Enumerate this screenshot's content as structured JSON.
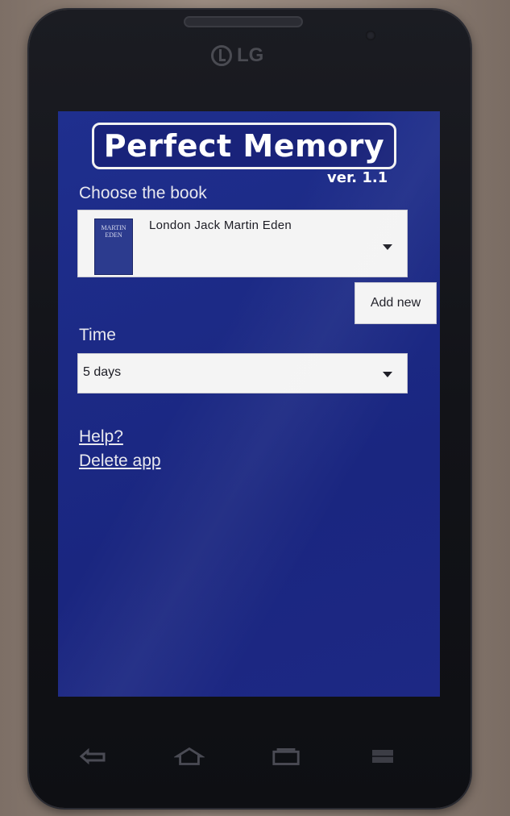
{
  "device": {
    "brand": "LG"
  },
  "app": {
    "title": "Perfect Memory",
    "version": "ver. 1.1"
  },
  "book_section": {
    "label": "Choose the book",
    "selected_book": "London Jack  Martin Eden",
    "cover_text": "MARTIN EDEN",
    "add_button": "Add new"
  },
  "time_section": {
    "label": "Time",
    "selected_value": "5 days"
  },
  "links": {
    "help": "Help?",
    "delete": "Delete app"
  },
  "nav_icons": [
    "back-icon",
    "home-icon",
    "recent-apps-icon",
    "menu-icon"
  ],
  "colors": {
    "screen_bg": "#1d2a88",
    "text": "#e8e8ef",
    "control_bg": "#f4f4f4"
  }
}
